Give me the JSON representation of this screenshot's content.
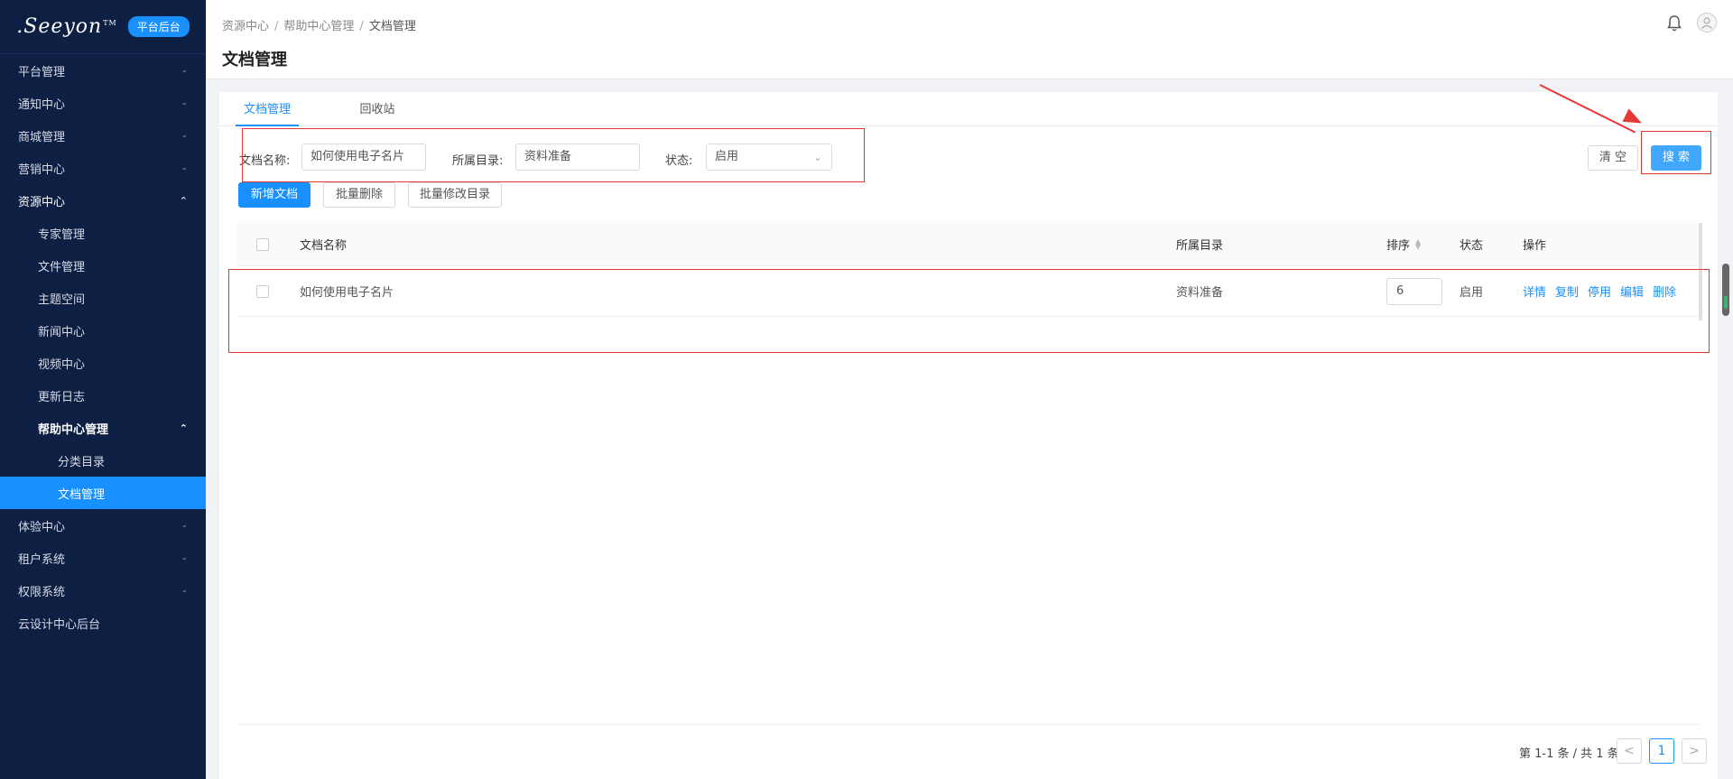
{
  "sidebar": {
    "logo_text": ".Seeyon",
    "logo_tm": "TM",
    "badge": "平台后台",
    "items": [
      {
        "label": "平台管理",
        "arrow": "⌄"
      },
      {
        "label": "通知中心",
        "arrow": "⌄"
      },
      {
        "label": "商城管理",
        "arrow": "⌄"
      },
      {
        "label": "营销中心",
        "arrow": "⌄"
      },
      {
        "label": "资源中心",
        "arrow": "⌃"
      },
      {
        "label": "专家管理"
      },
      {
        "label": "文件管理"
      },
      {
        "label": "主题空间"
      },
      {
        "label": "新闻中心"
      },
      {
        "label": "视频中心"
      },
      {
        "label": "更新日志"
      },
      {
        "label": "帮助中心管理",
        "arrow": "⌃"
      },
      {
        "label": "分类目录"
      },
      {
        "label": "文档管理"
      },
      {
        "label": "体验中心",
        "arrow": "⌄"
      },
      {
        "label": "租户系统",
        "arrow": "⌄"
      },
      {
        "label": "权限系统",
        "arrow": "⌄"
      },
      {
        "label": "云设计中心后台"
      }
    ]
  },
  "header": {
    "breadcrumb": [
      "资源中心",
      "帮助中心管理",
      "文档管理"
    ],
    "separator": "/",
    "title": "文档管理"
  },
  "tabs": [
    "文档管理",
    "回收站"
  ],
  "filters": {
    "name_label": "文档名称:",
    "name_value": "如何使用电子名片",
    "dir_label": "所属目录:",
    "dir_value": "资料准备",
    "status_label": "状态:",
    "status_value": "启用"
  },
  "buttons": {
    "clear": "清 空",
    "search": "搜 索",
    "add": "新增文档",
    "batch_delete": "批量删除",
    "batch_move": "批量修改目录"
  },
  "table": {
    "headers": {
      "name": "文档名称",
      "dir": "所属目录",
      "order": "排序",
      "status": "状态",
      "ops": "操作"
    },
    "rows": [
      {
        "name": "如何使用电子名片",
        "dir": "资料准备",
        "order": "6",
        "status": "启用"
      }
    ],
    "ops": [
      "详情",
      "复制",
      "停用",
      "编辑",
      "删除"
    ]
  },
  "pagination": {
    "summary": "第 1-1 条 / 共 1 条",
    "prev": "<",
    "next": ">",
    "current_page": "1"
  },
  "colors": {
    "sidebar_bg": "#0e1f44",
    "accent": "#1890ff",
    "annotation_red": "#e53935"
  }
}
